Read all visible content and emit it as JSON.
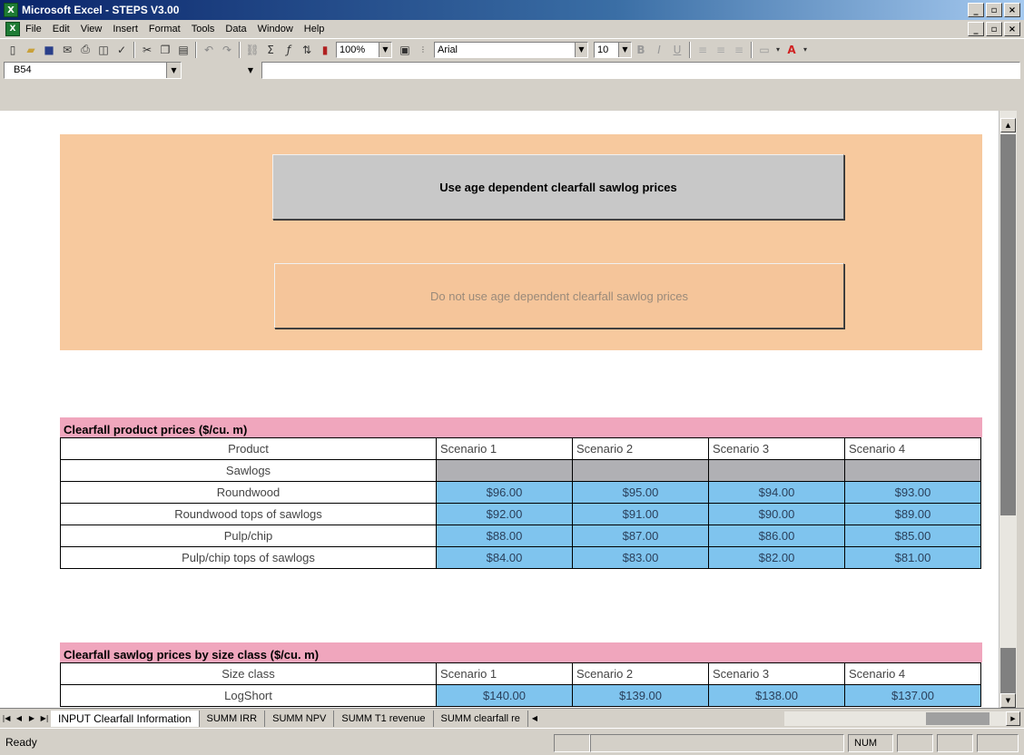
{
  "window": {
    "title": "Microsoft Excel - STEPS V3.00",
    "app_glyph": "X",
    "min": "_",
    "max": "▫",
    "close": "×"
  },
  "menu": [
    "File",
    "Edit",
    "View",
    "Insert",
    "Format",
    "Tools",
    "Data",
    "Window",
    "Help"
  ],
  "toolbar": {
    "zoom": "100%",
    "font": "Arial",
    "size": "10"
  },
  "formula": {
    "cell_ref": "B54"
  },
  "buttons": {
    "use_age": "Use age dependent clearfall sawlog prices",
    "no_age": "Do not use age dependent clearfall sawlog prices"
  },
  "table1": {
    "title": "Clearfall product prices ($/cu. m)",
    "headers": [
      "Product",
      "Scenario 1",
      "Scenario 2",
      "Scenario 3",
      "Scenario 4"
    ],
    "rows": [
      {
        "label": "Sawlogs",
        "values": [
          "",
          "",
          "",
          ""
        ]
      },
      {
        "label": "Roundwood",
        "values": [
          "$96.00",
          "$95.00",
          "$94.00",
          "$93.00"
        ]
      },
      {
        "label": "Roundwood tops of sawlogs",
        "values": [
          "$92.00",
          "$91.00",
          "$90.00",
          "$89.00"
        ]
      },
      {
        "label": "Pulp/chip",
        "values": [
          "$88.00",
          "$87.00",
          "$86.00",
          "$85.00"
        ]
      },
      {
        "label": "Pulp/chip tops of sawlogs",
        "values": [
          "$84.00",
          "$83.00",
          "$82.00",
          "$81.00"
        ]
      }
    ]
  },
  "table2": {
    "title": "Clearfall sawlog prices by size class ($/cu. m)",
    "headers": [
      "Size class",
      "Scenario 1",
      "Scenario 2",
      "Scenario 3",
      "Scenario 4"
    ],
    "rows": [
      {
        "label": "LogShort",
        "values": [
          "$140.00",
          "$139.00",
          "$138.00",
          "$137.00"
        ]
      }
    ]
  },
  "tabs": [
    "INPUT Clearfall Information",
    "SUMM IRR",
    "SUMM NPV",
    "SUMM T1 revenue",
    "SUMM clearfall re"
  ],
  "status": {
    "left": "Ready",
    "num": "NUM"
  }
}
